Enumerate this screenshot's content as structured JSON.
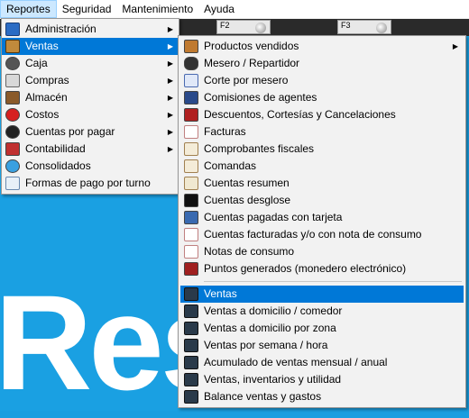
{
  "menubar": [
    "Reportes",
    "Seguridad",
    "Mantenimiento",
    "Ayuda"
  ],
  "fkeys": [
    "F2",
    "F3"
  ],
  "background_text": "Res",
  "reportes_menu": [
    {
      "label": "Administración",
      "icon": "monitor-icon",
      "submenu": true
    },
    {
      "label": "Ventas",
      "icon": "ventas-icon",
      "submenu": true,
      "selected": true
    },
    {
      "label": "Caja",
      "icon": "cash-icon",
      "submenu": true
    },
    {
      "label": "Compras",
      "icon": "cart-icon",
      "submenu": true
    },
    {
      "label": "Almacén",
      "icon": "warehouse-icon",
      "submenu": true
    },
    {
      "label": "Costos",
      "icon": "costs-icon",
      "submenu": true
    },
    {
      "label": "Cuentas por pagar",
      "icon": "payables-icon",
      "submenu": true
    },
    {
      "label": "Contabilidad",
      "icon": "accounting-icon",
      "submenu": true
    },
    {
      "label": "Consolidados",
      "icon": "globe-icon",
      "submenu": false
    },
    {
      "label": "Formas de pago por turno",
      "icon": "payment-forms-icon",
      "submenu": false
    }
  ],
  "ventas_menu_top": [
    {
      "label": "Productos vendidos",
      "icon": "products-icon",
      "submenu": true
    },
    {
      "label": "Mesero / Repartidor",
      "icon": "waiter-icon"
    },
    {
      "label": "Corte por mesero",
      "icon": "cut-icon"
    },
    {
      "label": "Comisiones de agentes",
      "icon": "commission-icon"
    },
    {
      "label": "Descuentos, Cortesías y Cancelaciones",
      "icon": "discount-icon"
    },
    {
      "label": "Facturas",
      "icon": "invoice-icon"
    },
    {
      "label": "Comprobantes fiscales",
      "icon": "fiscal-icon"
    },
    {
      "label": "Comandas",
      "icon": "order-icon"
    },
    {
      "label": "Cuentas resumen",
      "icon": "summary-icon"
    },
    {
      "label": "Cuentas desglose",
      "icon": "breakdown-icon"
    },
    {
      "label": "Cuentas pagadas con tarjeta",
      "icon": "card-icon"
    },
    {
      "label": "Cuentas facturadas y/o con nota de consumo",
      "icon": "billed-icon"
    },
    {
      "label": "Notas de consumo",
      "icon": "note-icon"
    },
    {
      "label": "Puntos generados (monedero electrónico)",
      "icon": "points-icon"
    }
  ],
  "ventas_menu_bottom": [
    {
      "label": "Ventas",
      "icon": "report-check-icon",
      "selected": true
    },
    {
      "label": "Ventas a domicilio / comedor",
      "icon": "report-check-icon"
    },
    {
      "label": "Ventas a domicilio por zona",
      "icon": "report-check-icon"
    },
    {
      "label": "Ventas por semana / hora",
      "icon": "report-check-icon"
    },
    {
      "label": "Acumulado de ventas mensual / anual",
      "icon": "report-check-icon"
    },
    {
      "label": "Ventas, inventarios y utilidad",
      "icon": "report-check-icon"
    },
    {
      "label": "Balance ventas y gastos",
      "icon": "report-check-icon"
    }
  ]
}
